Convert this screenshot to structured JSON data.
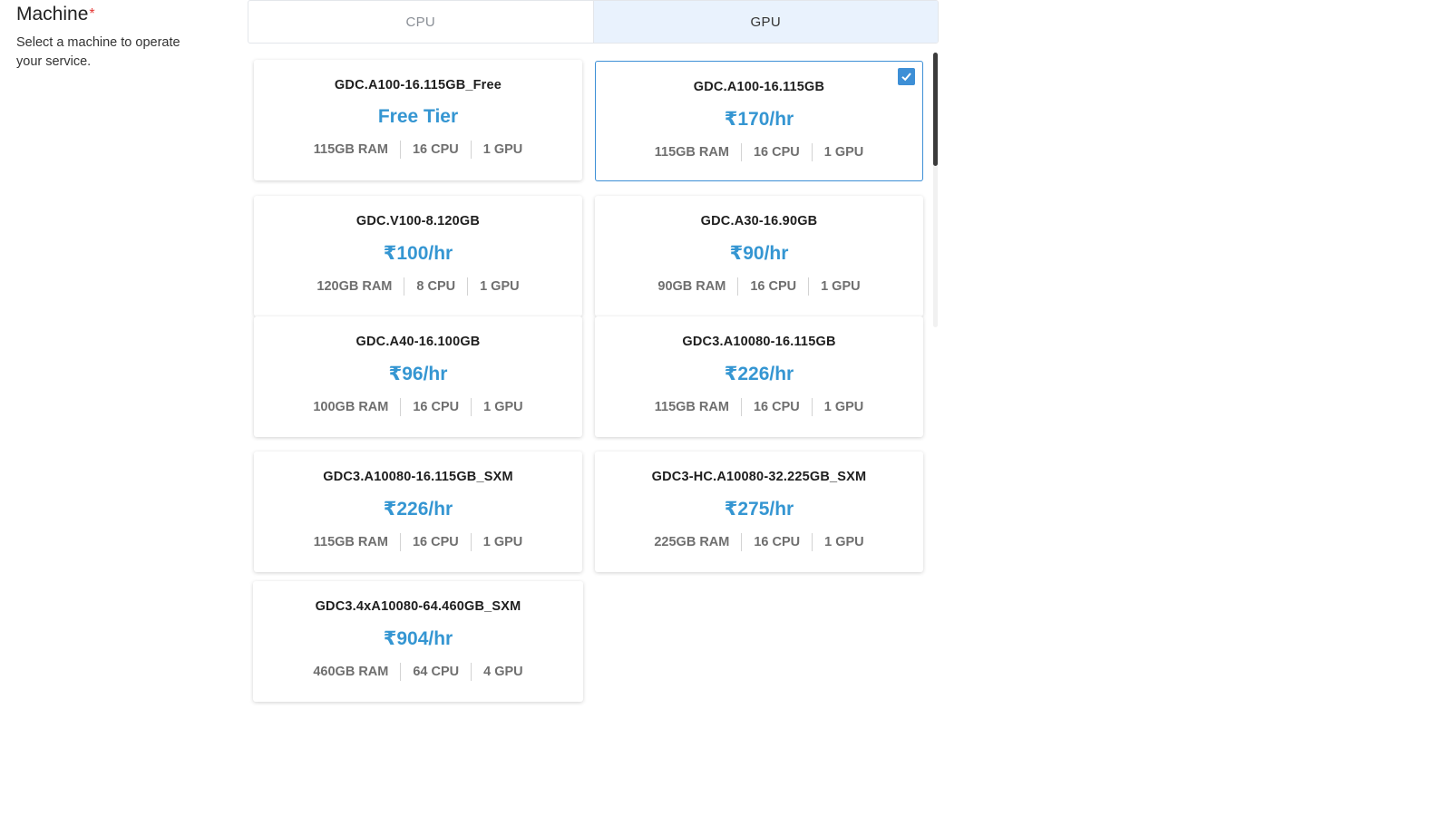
{
  "field": {
    "title": "Machine",
    "required_mark": "*",
    "description": "Select a machine to operate your service."
  },
  "tabs": [
    {
      "label": "CPU",
      "active": false
    },
    {
      "label": "GPU",
      "active": true
    }
  ],
  "colors": {
    "accent": "#3d8fd6",
    "price": "#3596d2",
    "active_tab_bg": "#e9f2fd",
    "required": "#e53935"
  },
  "machines": [
    {
      "name": "GDC.A100-16.115GB_Free",
      "price": "Free Tier",
      "ram": "115GB RAM",
      "cpu": "16 CPU",
      "gpu": "1 GPU",
      "selected": false
    },
    {
      "name": "GDC.A100-16.115GB",
      "price": "₹170/hr",
      "ram": "115GB RAM",
      "cpu": "16 CPU",
      "gpu": "1 GPU",
      "selected": true
    },
    {
      "name": "GDC.V100-8.120GB",
      "price": "₹100/hr",
      "ram": "120GB RAM",
      "cpu": "8 CPU",
      "gpu": "1 GPU",
      "selected": false
    },
    {
      "name": "GDC.A30-16.90GB",
      "price": "₹90/hr",
      "ram": "90GB RAM",
      "cpu": "16 CPU",
      "gpu": "1 GPU",
      "selected": false
    },
    {
      "name": "GDC.A40-16.100GB",
      "price": "₹96/hr",
      "ram": "100GB RAM",
      "cpu": "16 CPU",
      "gpu": "1 GPU",
      "selected": false
    },
    {
      "name": "GDC3.A10080-16.115GB",
      "price": "₹226/hr",
      "ram": "115GB RAM",
      "cpu": "16 CPU",
      "gpu": "1 GPU",
      "selected": false
    },
    {
      "name": "GDC3.A10080-16.115GB_SXM",
      "price": "₹226/hr",
      "ram": "115GB RAM",
      "cpu": "16 CPU",
      "gpu": "1 GPU",
      "selected": false
    },
    {
      "name": "GDC3-HC.A10080-32.225GB_SXM",
      "price": "₹275/hr",
      "ram": "225GB RAM",
      "cpu": "16 CPU",
      "gpu": "1 GPU",
      "selected": false
    },
    {
      "name": "GDC3.4xA10080-64.460GB_SXM",
      "price": "₹904/hr",
      "ram": "460GB RAM",
      "cpu": "64 CPU",
      "gpu": "4 GPU",
      "selected": false
    }
  ]
}
